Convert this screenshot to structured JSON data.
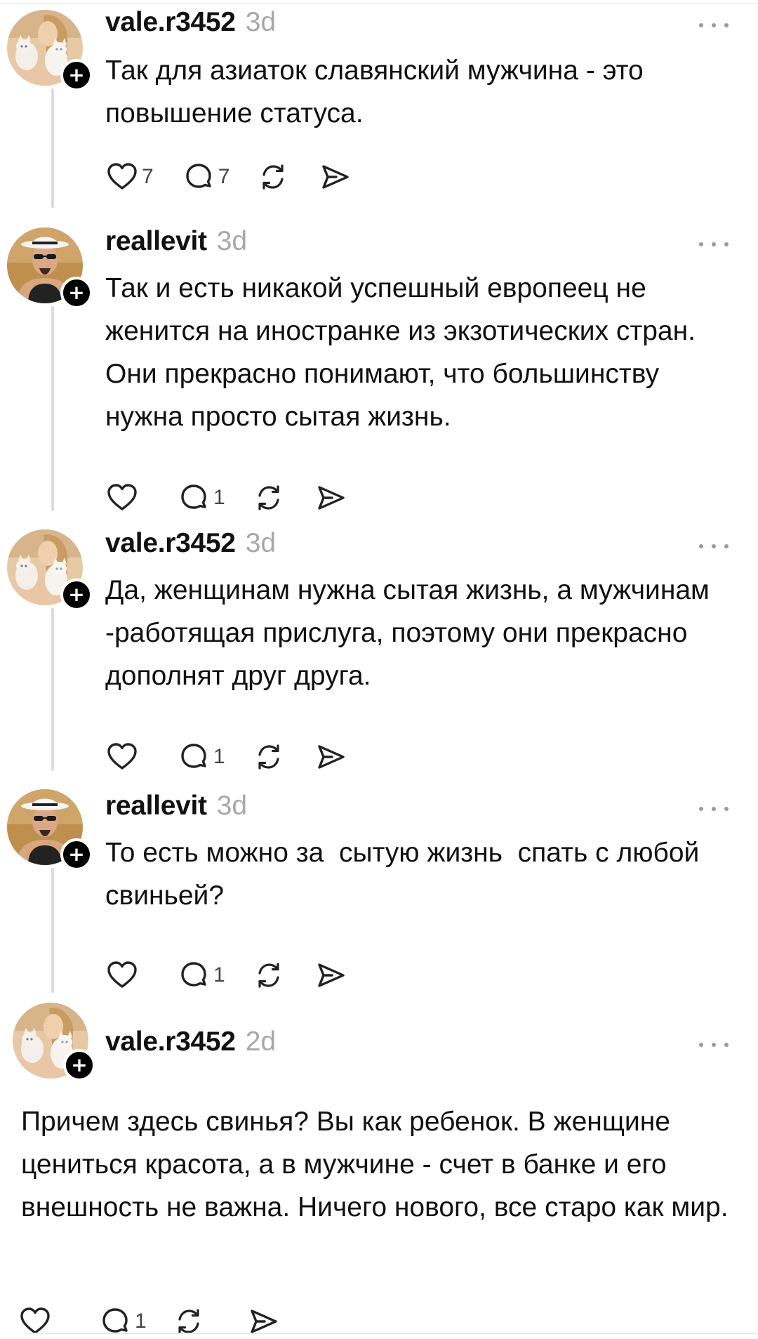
{
  "posts": [
    {
      "username": "vale.r3452",
      "time": "3d",
      "text": "Так для азиаток славянский мужчина - это повышение статуса.",
      "likes": "7",
      "comments": "7",
      "avatar_icon": "avatar-woman-with-cats"
    },
    {
      "username": "reallevit",
      "time": "3d",
      "text": "Так и есть никакой успешный европеец не женится на иностранке из экзотических стран. Они прекрасно понимают, что большинству нужна просто сытая жизнь.",
      "likes": "",
      "comments": "1",
      "avatar_icon": "avatar-man-in-hat"
    },
    {
      "username": "vale.r3452",
      "time": "3d",
      "text": "Да, женщинам нужна сытая жизнь, а мужчинам -работящая прислуга, поэтому они прекрасно дополнят друг друга.",
      "likes": "",
      "comments": "1",
      "avatar_icon": "avatar-woman-with-cats"
    },
    {
      "username": "reallevit",
      "time": "3d",
      "text": "То есть можно за  сытую жизнь  спать с любой свиньей?",
      "likes": "",
      "comments": "1",
      "avatar_icon": "avatar-man-in-hat"
    },
    {
      "username": "vale.r3452",
      "time": "2d",
      "text": "Причем здесь свинья? Вы как ребенок. В женщине цениться красота, а в мужчине - счет в банке и его внешность не важна. Ничего нового, все старо как мир.",
      "likes": "",
      "comments": "1",
      "avatar_icon": "avatar-woman-with-cats"
    }
  ],
  "icons": {
    "like": "heart-icon",
    "comment": "comment-bubble-icon",
    "repost": "repost-icon",
    "share": "send-icon",
    "more": "more-dots-icon",
    "follow": "plus-icon"
  }
}
